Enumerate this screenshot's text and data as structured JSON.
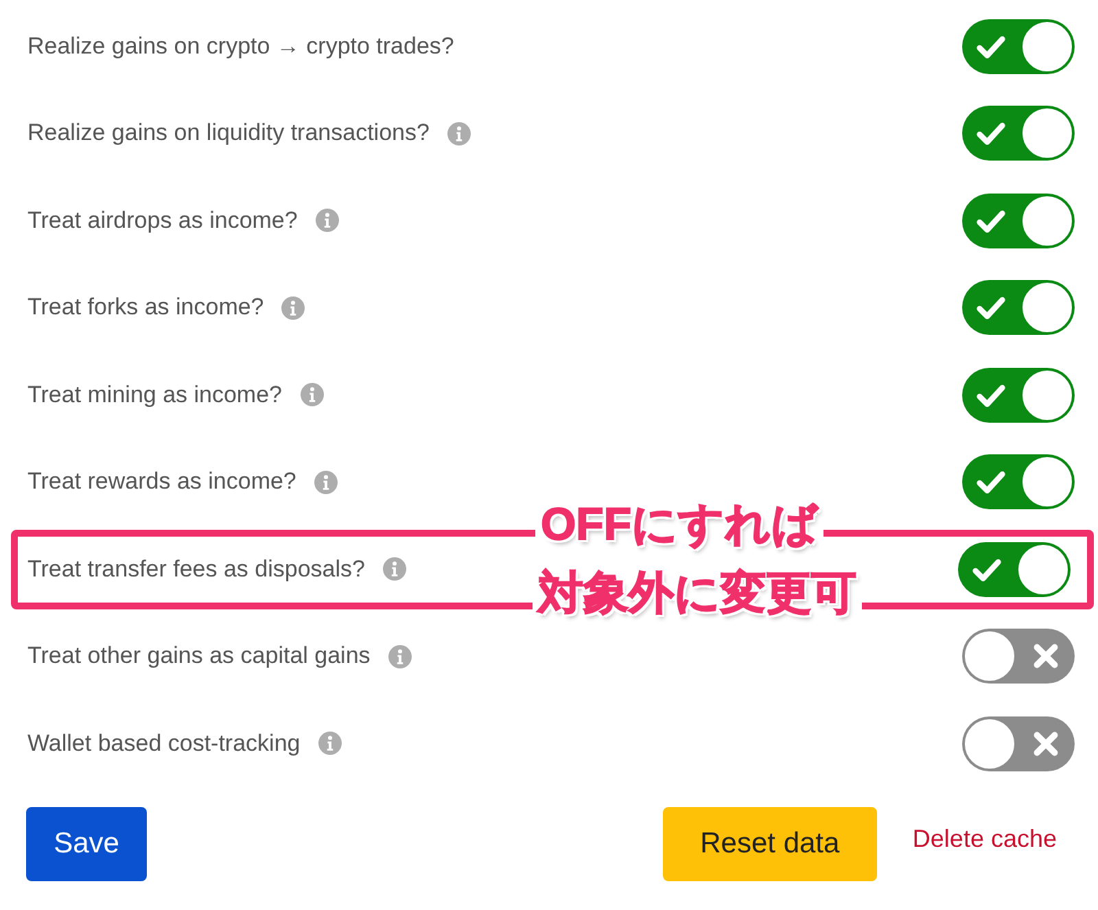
{
  "settings": [
    {
      "label": "Realize gains on crypto → crypto trades?",
      "info": false,
      "on": true,
      "highlighted": false
    },
    {
      "label": "Realize gains on liquidity transactions?",
      "info": true,
      "on": true,
      "highlighted": false
    },
    {
      "label": "Treat airdrops as income?",
      "info": true,
      "on": true,
      "highlighted": false
    },
    {
      "label": "Treat forks as income?",
      "info": true,
      "on": true,
      "highlighted": false
    },
    {
      "label": "Treat mining as income?",
      "info": true,
      "on": true,
      "highlighted": false
    },
    {
      "label": "Treat rewards as income?",
      "info": true,
      "on": true,
      "highlighted": false
    },
    {
      "label": "Treat transfer fees as disposals?",
      "info": true,
      "on": true,
      "highlighted": true
    },
    {
      "label": "Treat other gains as capital gains",
      "info": true,
      "on": false,
      "highlighted": false
    },
    {
      "label": "Wallet based cost-tracking",
      "info": true,
      "on": false,
      "highlighted": false
    }
  ],
  "annotation": [
    "OFFにすれば",
    "対象外に変更可"
  ],
  "buttons": {
    "save": "Save",
    "reset": "Reset data",
    "delete": "Delete cache"
  }
}
